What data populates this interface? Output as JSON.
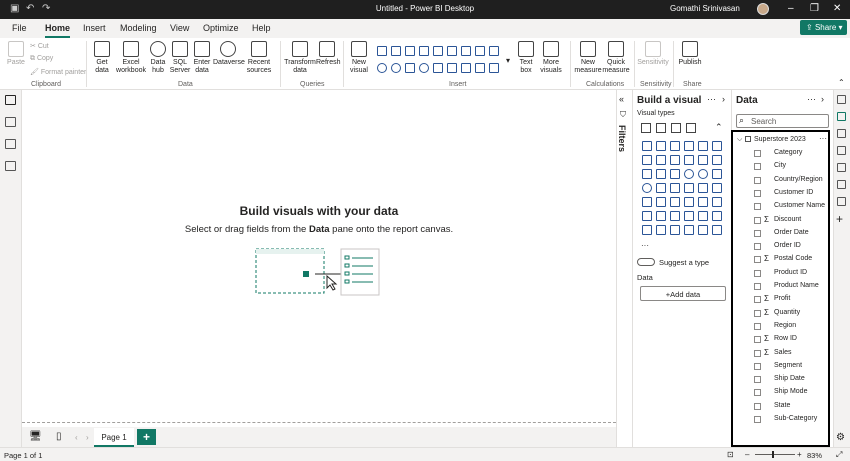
{
  "titlebar": {
    "title": "Untitled - Power BI Desktop",
    "user": "Gomathi Srinivasan"
  },
  "menu": {
    "items": [
      "File",
      "Home",
      "Insert",
      "Modeling",
      "View",
      "Optimize",
      "Help"
    ],
    "active": "Home",
    "share": "Share"
  },
  "ribbon": {
    "clipboard": {
      "paste": "Paste",
      "cut": "Cut",
      "copy": "Copy",
      "format_painter": "Format painter",
      "group": "Clipboard"
    },
    "data": {
      "get_data": "Get data",
      "excel": "Excel workbook",
      "hub": "Data hub",
      "sql": "SQL Server",
      "enter": "Enter data",
      "dataverse": "Dataverse",
      "recent": "Recent sources",
      "group": "Data"
    },
    "queries": {
      "transform": "Transform data",
      "refresh": "Refresh",
      "group": "Queries"
    },
    "insert": {
      "new_visual": "New visual",
      "text_box": "Text box",
      "more_visuals": "More visuals",
      "group": "Insert"
    },
    "calculations": {
      "new_measure": "New measure",
      "quick_measure": "Quick measure",
      "group": "Calculations"
    },
    "sensitivity": {
      "label": "Sensitivity",
      "group": "Sensitivity"
    },
    "share": {
      "publish": "Publish",
      "group": "Share"
    }
  },
  "canvas": {
    "heading": "Build visuals with your data",
    "sub_pre": "Select or drag fields from the ",
    "sub_bold": "Data",
    "sub_post": " pane onto the report canvas."
  },
  "pages": {
    "tab": "Page 1",
    "add": "+",
    "status": "Page 1 of 1",
    "zoom": "83%"
  },
  "filters": {
    "label": "Filters"
  },
  "build": {
    "title": "Build a visual",
    "visual_types": "Visual types",
    "suggest": "Suggest a type",
    "data_label": "Data",
    "add_data": "+Add data"
  },
  "data_pane": {
    "title": "Data",
    "search_placeholder": "Search",
    "table": "Superstore 2023",
    "fields": [
      {
        "name": "Category",
        "sigma": ""
      },
      {
        "name": "City",
        "sigma": ""
      },
      {
        "name": "Country/Region",
        "sigma": ""
      },
      {
        "name": "Customer ID",
        "sigma": ""
      },
      {
        "name": "Customer Name",
        "sigma": ""
      },
      {
        "name": "Discount",
        "sigma": "Σ"
      },
      {
        "name": "Order Date",
        "sigma": ""
      },
      {
        "name": "Order ID",
        "sigma": ""
      },
      {
        "name": "Postal Code",
        "sigma": "Σ"
      },
      {
        "name": "Product ID",
        "sigma": ""
      },
      {
        "name": "Product Name",
        "sigma": ""
      },
      {
        "name": "Profit",
        "sigma": "Σ"
      },
      {
        "name": "Quantity",
        "sigma": "Σ"
      },
      {
        "name": "Region",
        "sigma": ""
      },
      {
        "name": "Row ID",
        "sigma": "Σ"
      },
      {
        "name": "Sales",
        "sigma": "Σ"
      },
      {
        "name": "Segment",
        "sigma": ""
      },
      {
        "name": "Ship Date",
        "sigma": ""
      },
      {
        "name": "Ship Mode",
        "sigma": ""
      },
      {
        "name": "State",
        "sigma": ""
      },
      {
        "name": "Sub-Category",
        "sigma": ""
      }
    ]
  },
  "colors": {
    "accent": "#117865",
    "visual_icon": "#2b5597",
    "titlebar": "#1f1f1f"
  }
}
